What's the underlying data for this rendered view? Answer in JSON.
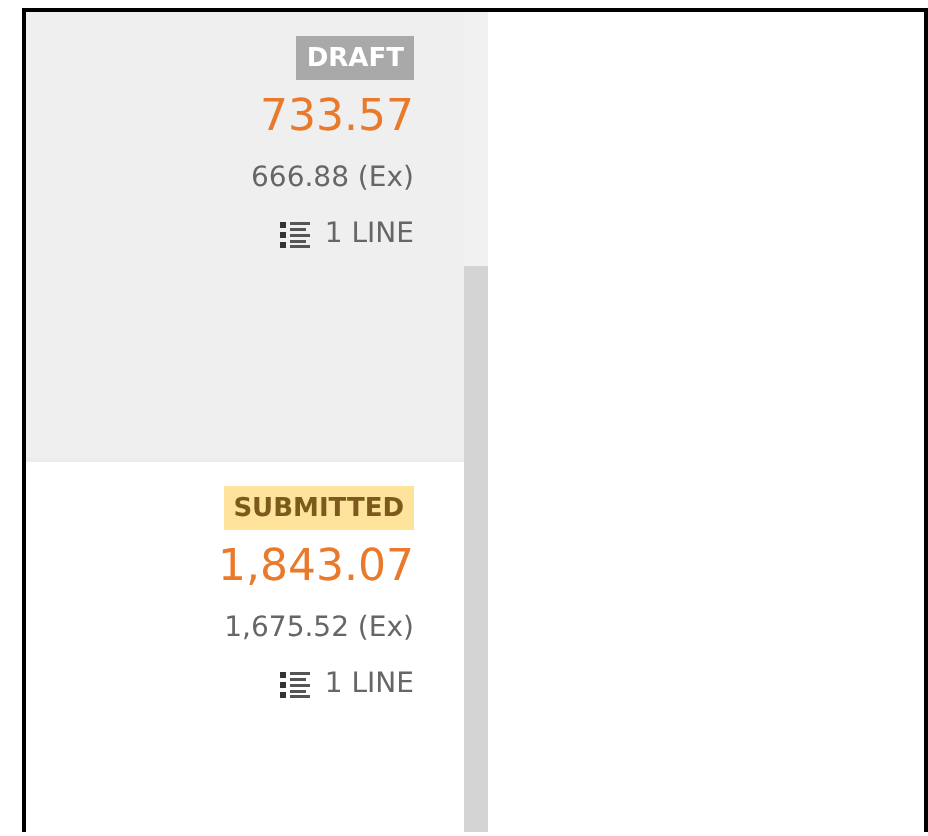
{
  "orders": [
    {
      "status": {
        "label": "DRAFT",
        "kind": "draft"
      },
      "total": "733.57",
      "ex_total": "666.88 (Ex)",
      "lines": "1 LINE",
      "selected": true
    },
    {
      "status": {
        "label": "SUBMITTED",
        "kind": "submitted"
      },
      "total": "1,843.07",
      "ex_total": "1,675.52 (Ex)",
      "lines": "1 LINE",
      "selected": false
    }
  ]
}
